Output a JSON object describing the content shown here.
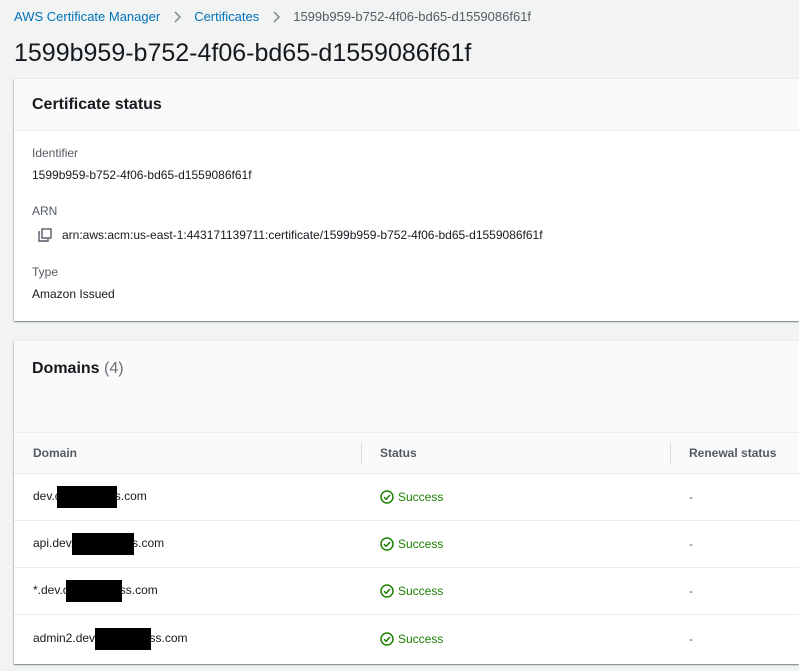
{
  "breadcrumb": {
    "items": [
      "AWS Certificate Manager",
      "Certificates"
    ],
    "current": "1599b959-b752-4f06-bd65-d1559086f61f"
  },
  "page": {
    "title": "1599b959-b752-4f06-bd65-d1559086f61f"
  },
  "status_panel": {
    "title": "Certificate status",
    "identifier_label": "Identifier",
    "identifier_value": "1599b959-b752-4f06-bd65-d1559086f61f",
    "arn_label": "ARN",
    "arn_value": "arn:aws:acm:us-east-1:443171139711:certificate/1599b959-b752-4f06-bd65-d1559086f61f",
    "type_label": "Type",
    "type_value": "Amazon Issued"
  },
  "domains_panel": {
    "title": "Domains",
    "count": "(4)",
    "columns": [
      "Domain",
      "Status",
      "Renewal status"
    ],
    "rows": [
      {
        "domain_prefix": "dev.c",
        "domain_suffix": "s.com",
        "status": "Success",
        "renewal": "-"
      },
      {
        "domain_prefix": "api.dev.",
        "domain_suffix": "s.com",
        "status": "Success",
        "renewal": "-"
      },
      {
        "domain_prefix": "*.dev.c",
        "domain_suffix": "ss.com",
        "status": "Success",
        "renewal": "-"
      },
      {
        "domain_prefix": "admin2.dev.",
        "domain_suffix": "ss.com",
        "status": "Success",
        "renewal": "-"
      }
    ]
  },
  "colors": {
    "link": "#0073bb",
    "success": "#1d8102",
    "background": "#f2f3f3"
  },
  "icons": {
    "breadcrumb_separator": "chevron-right-icon",
    "copy": "copy-icon",
    "success": "status-success-icon"
  }
}
